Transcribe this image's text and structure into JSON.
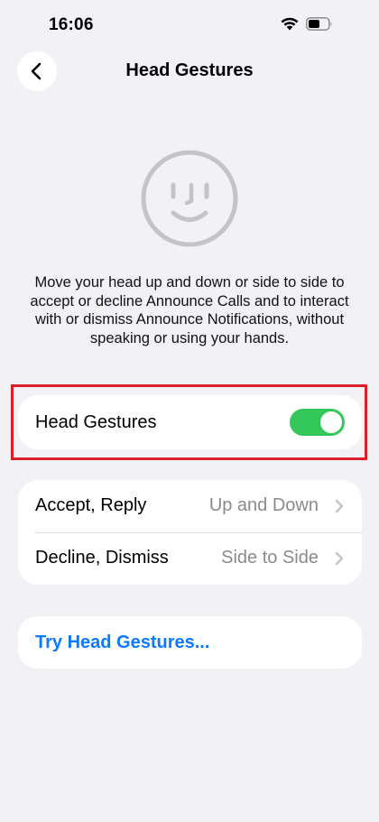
{
  "status_bar": {
    "time": "16:06"
  },
  "nav": {
    "title": "Head Gestures",
    "back_icon": "chevron-left-icon"
  },
  "illustration": {
    "icon": "face-icon"
  },
  "description": "Move your head up and down or side to side to accept or decline Announce Calls and to interact with or dismiss Announce Notifications, without speaking or using your hands.",
  "toggle": {
    "label": "Head Gestures",
    "state": "on"
  },
  "settings": {
    "rows": [
      {
        "label": "Accept, Reply",
        "value": "Up and Down"
      },
      {
        "label": "Decline, Dismiss",
        "value": "Side to Side"
      }
    ]
  },
  "try": {
    "label": "Try Head Gestures..."
  },
  "colors": {
    "background": "#f2f1f6",
    "toggle_on": "#34c759",
    "link": "#0a7aff",
    "highlight": "#d9202a",
    "secondary_text": "#8a8a8e"
  }
}
